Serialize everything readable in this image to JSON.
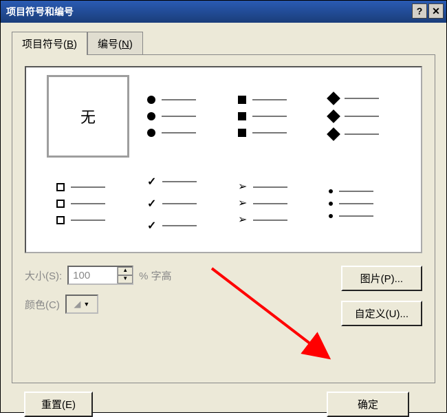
{
  "title": "项目符号和编号",
  "tabs": {
    "bullets": {
      "label": "项目符号(",
      "accel": "B",
      "suffix": ")"
    },
    "numbers": {
      "label": "编号(",
      "accel": "N",
      "suffix": ")"
    }
  },
  "bullets": {
    "none": "无"
  },
  "controls": {
    "size_label": "大小(S):",
    "size_value": "100",
    "size_suffix": "% 字高",
    "color_label": "颜色(C)",
    "picture_label": "图片(P)...",
    "custom_label": "自定义(U)..."
  },
  "buttons": {
    "reset": "重置(E)",
    "ok": "确定"
  }
}
